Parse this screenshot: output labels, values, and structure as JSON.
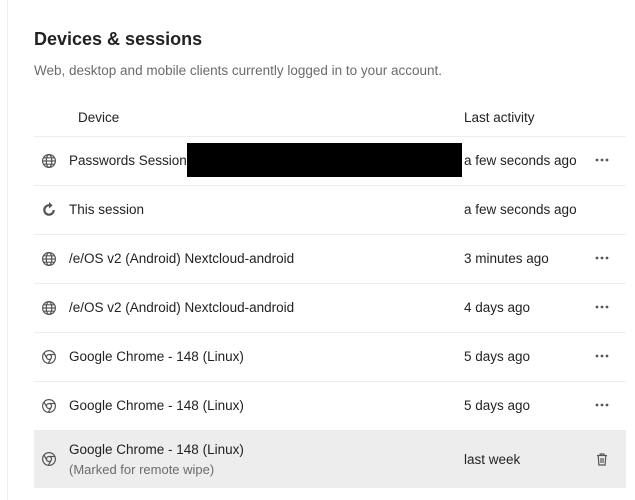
{
  "section": {
    "title": "Devices & sessions",
    "description": "Web, desktop and mobile clients currently logged in to your account."
  },
  "table": {
    "headers": {
      "device": "Device",
      "last_activity": "Last activity"
    },
    "rows": [
      {
        "icon": "globe-icon",
        "device": "Passwords Session",
        "redacted": true,
        "sub": "",
        "activity": "a few seconds ago",
        "action": "more-icon"
      },
      {
        "icon": "refresh-icon",
        "device": "This session",
        "redacted": false,
        "sub": "",
        "activity": "a few seconds ago",
        "action": ""
      },
      {
        "icon": "globe-icon",
        "device": "/e/OS v2 (Android) Nextcloud-android",
        "redacted": false,
        "sub": "",
        "activity": "3 minutes ago",
        "action": "more-icon"
      },
      {
        "icon": "globe-icon",
        "device": "/e/OS v2 (Android) Nextcloud-android",
        "redacted": false,
        "sub": "",
        "activity": "4 days ago",
        "action": "more-icon"
      },
      {
        "icon": "chrome-icon",
        "device": "Google Chrome - 148 (Linux)",
        "redacted": false,
        "sub": "",
        "activity": "5 days ago",
        "action": "more-icon"
      },
      {
        "icon": "chrome-icon",
        "device": "Google Chrome - 148 (Linux)",
        "redacted": false,
        "sub": "",
        "activity": "5 days ago",
        "action": "more-icon"
      },
      {
        "icon": "chrome-icon",
        "device": "Google Chrome - 148 (Linux)",
        "redacted": false,
        "sub": "(Marked for remote wipe)",
        "activity": "last week",
        "action": "trash-icon",
        "highlighted": true
      }
    ]
  },
  "colors": {
    "text": "#222222",
    "muted": "#6b6b6b",
    "border": "#ededed",
    "highlight_row": "#ededed",
    "redaction": "#000000"
  }
}
